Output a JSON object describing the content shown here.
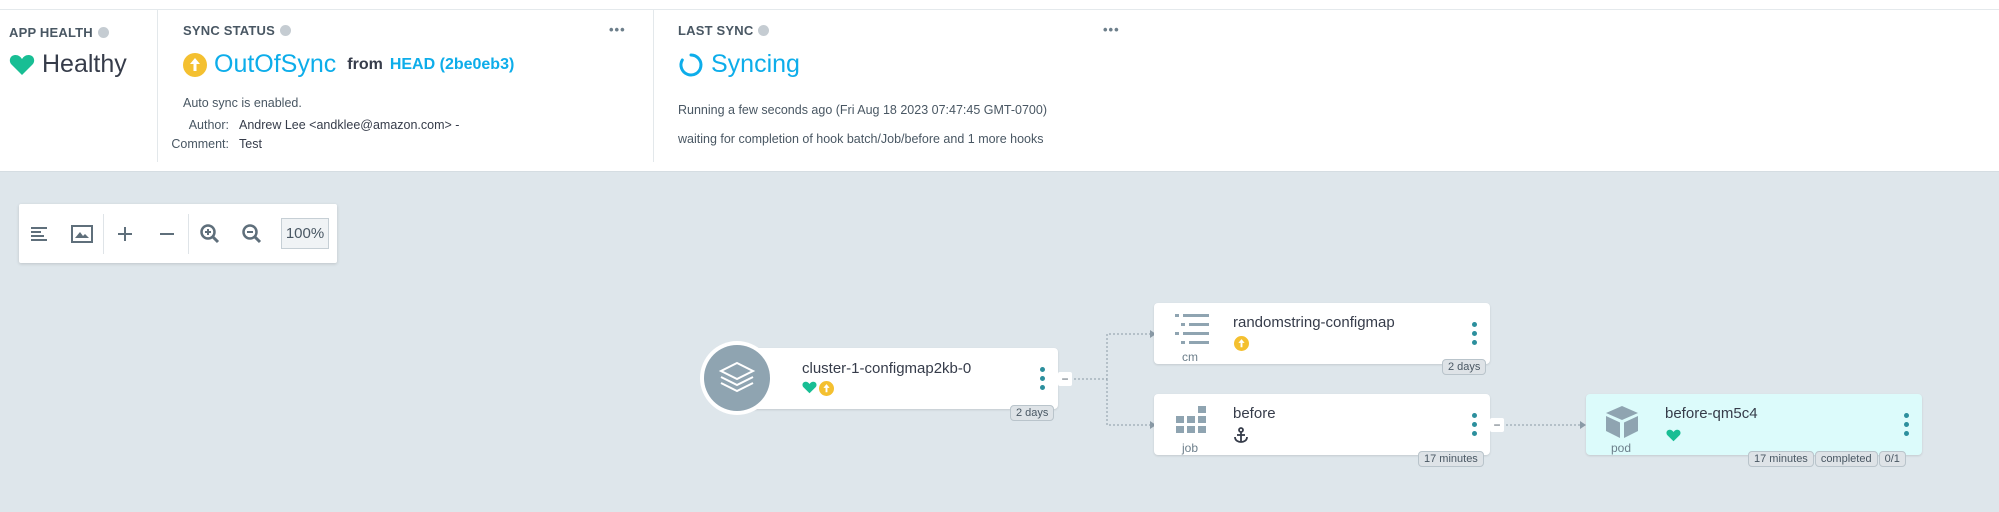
{
  "app_health": {
    "title": "APP HEALTH",
    "status": "Healthy",
    "color": "#18be94"
  },
  "sync_status": {
    "title": "SYNC STATUS",
    "status": "OutOfSync",
    "from_label": "from",
    "revision": "HEAD (2be0eb3)",
    "auto_sync": "Auto sync is enabled.",
    "author_label": "Author:",
    "author": "Andrew Lee <andklee@amazon.com> -",
    "comment_label": "Comment:",
    "comment": "Test",
    "color": "#f4c030",
    "menu_icon": "ellipsis-icon"
  },
  "last_sync": {
    "title": "LAST SYNC",
    "status": "Syncing",
    "running": "Running a few seconds ago (Fri Aug 18 2023 07:47:45 GMT-0700)",
    "message": "waiting for completion of hook batch/Job/before and 1 more hooks",
    "color": "#0dadea",
    "menu_icon": "ellipsis-icon"
  },
  "toolbar": {
    "icons": [
      "tree-view-icon",
      "fit-to-screen-icon",
      "expand-icon",
      "collapse-icon",
      "zoom-in-icon",
      "zoom-out-icon"
    ],
    "zoom": "100%"
  },
  "graph": {
    "app_node": {
      "name": "cluster-1-configmap2kb-0",
      "age": "2 days",
      "collapse": "−"
    },
    "cm_node": {
      "name": "randomstring-configmap",
      "kind": "cm",
      "age": "2 days"
    },
    "job_node": {
      "name": "before",
      "kind": "job",
      "age": "17 minutes",
      "collapse": "−"
    },
    "pod_node": {
      "name": "before-qm5c4",
      "kind": "pod",
      "age": "17 minutes",
      "state": "completed",
      "ready": "0/1"
    }
  }
}
